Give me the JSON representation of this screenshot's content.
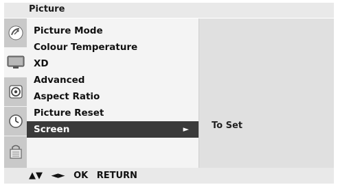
{
  "header": {
    "title": "Picture"
  },
  "sidebar": {
    "icons": [
      {
        "name": "satellite-dish-icon",
        "active": false
      },
      {
        "name": "tv-screen-icon",
        "active": true
      },
      {
        "name": "speaker-icon",
        "active": false
      },
      {
        "name": "clock-icon",
        "active": false
      },
      {
        "name": "lock-icon",
        "active": false
      }
    ]
  },
  "menu": {
    "items": [
      {
        "label": "Picture Mode"
      },
      {
        "label": "Colour Temperature"
      },
      {
        "label": "XD"
      },
      {
        "label": "Advanced"
      },
      {
        "label": "Aspect Ratio"
      },
      {
        "label": "Picture Reset"
      },
      {
        "label": "Screen",
        "arrow": "►"
      }
    ],
    "selected_index": 6
  },
  "submenu": {
    "value": "To Set"
  },
  "footer": {
    "updown": "▲▼",
    "leftright": "◄►",
    "ok": "OK",
    "return": "RETURN"
  },
  "colors": {
    "selected_bg": "#3a3a3a",
    "menu_bg": "#f4f4f4",
    "frame_bg": "#e0e0e0"
  }
}
